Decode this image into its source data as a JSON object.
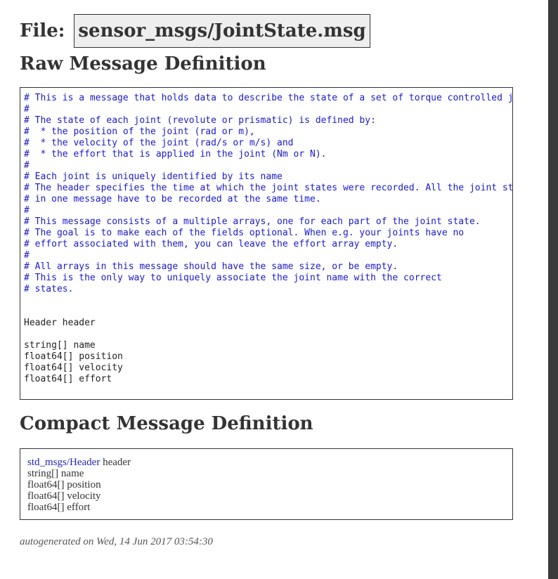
{
  "file_heading": {
    "label": "File:",
    "filename": "sensor_msgs/JointState.msg"
  },
  "raw_section": {
    "title": "Raw Message Definition",
    "lines": [
      {
        "text": "# This is a message that holds data to describe the state of a set of torque controlled joints.",
        "kind": "comment"
      },
      {
        "text": "#",
        "kind": "comment"
      },
      {
        "text": "# The state of each joint (revolute or prismatic) is defined by:",
        "kind": "comment"
      },
      {
        "text": "#  * the position of the joint (rad or m),",
        "kind": "comment"
      },
      {
        "text": "#  * the velocity of the joint (rad/s or m/s) and",
        "kind": "comment"
      },
      {
        "text": "#  * the effort that is applied in the joint (Nm or N).",
        "kind": "comment"
      },
      {
        "text": "#",
        "kind": "comment"
      },
      {
        "text": "# Each joint is uniquely identified by its name",
        "kind": "comment"
      },
      {
        "text": "# The header specifies the time at which the joint states were recorded. All the joint states",
        "kind": "comment"
      },
      {
        "text": "# in one message have to be recorded at the same time.",
        "kind": "comment"
      },
      {
        "text": "#",
        "kind": "comment"
      },
      {
        "text": "# This message consists of a multiple arrays, one for each part of the joint state.",
        "kind": "comment"
      },
      {
        "text": "# The goal is to make each of the fields optional. When e.g. your joints have no",
        "kind": "comment"
      },
      {
        "text": "# effort associated with them, you can leave the effort array empty.",
        "kind": "comment"
      },
      {
        "text": "#",
        "kind": "comment"
      },
      {
        "text": "# All arrays in this message should have the same size, or be empty.",
        "kind": "comment"
      },
      {
        "text": "# This is the only way to uniquely associate the joint name with the correct",
        "kind": "comment"
      },
      {
        "text": "# states.",
        "kind": "comment"
      },
      {
        "text": "",
        "kind": "blank"
      },
      {
        "text": "",
        "kind": "blank"
      },
      {
        "text": "Header header",
        "kind": "code"
      },
      {
        "text": "",
        "kind": "blank"
      },
      {
        "text": "string[] name",
        "kind": "code"
      },
      {
        "text": "float64[] position",
        "kind": "code"
      },
      {
        "text": "float64[] velocity",
        "kind": "code"
      },
      {
        "text": "float64[] effort",
        "kind": "code"
      }
    ]
  },
  "compact_section": {
    "title": "Compact Message Definition",
    "header_type": "std_msgs/Header",
    "header_field": " header",
    "fields": [
      "string[] name",
      "float64[] position",
      "float64[] velocity",
      "float64[] effort"
    ]
  },
  "footer": {
    "text": "autogenerated on Wed, 14 Jun 2017 03:54:30"
  },
  "colors": {
    "comment": "#1a1acc",
    "link": "#2222bb",
    "text": "#333333",
    "filename_bg": "#eeeeee"
  }
}
